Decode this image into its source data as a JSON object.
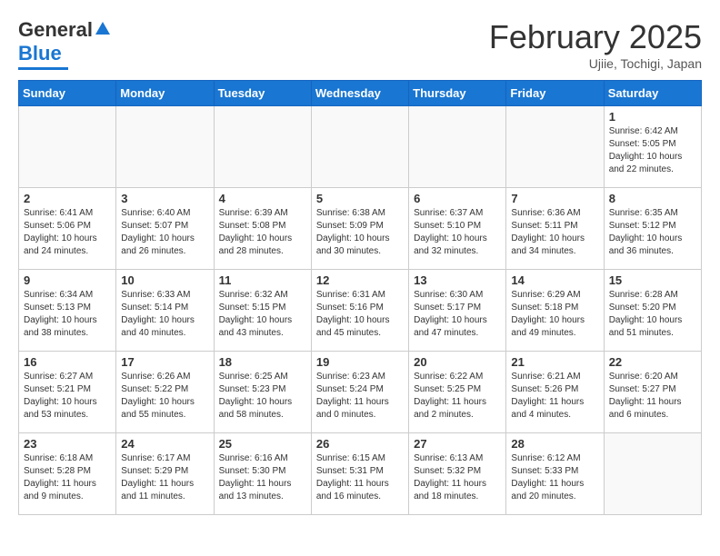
{
  "header": {
    "logo_general": "General",
    "logo_blue": "Blue",
    "month_title": "February 2025",
    "location": "Ujiie, Tochigi, Japan"
  },
  "weekdays": [
    "Sunday",
    "Monday",
    "Tuesday",
    "Wednesday",
    "Thursday",
    "Friday",
    "Saturday"
  ],
  "weeks": [
    [
      {
        "day": "",
        "info": ""
      },
      {
        "day": "",
        "info": ""
      },
      {
        "day": "",
        "info": ""
      },
      {
        "day": "",
        "info": ""
      },
      {
        "day": "",
        "info": ""
      },
      {
        "day": "",
        "info": ""
      },
      {
        "day": "1",
        "info": "Sunrise: 6:42 AM\nSunset: 5:05 PM\nDaylight: 10 hours and 22 minutes."
      }
    ],
    [
      {
        "day": "2",
        "info": "Sunrise: 6:41 AM\nSunset: 5:06 PM\nDaylight: 10 hours and 24 minutes."
      },
      {
        "day": "3",
        "info": "Sunrise: 6:40 AM\nSunset: 5:07 PM\nDaylight: 10 hours and 26 minutes."
      },
      {
        "day": "4",
        "info": "Sunrise: 6:39 AM\nSunset: 5:08 PM\nDaylight: 10 hours and 28 minutes."
      },
      {
        "day": "5",
        "info": "Sunrise: 6:38 AM\nSunset: 5:09 PM\nDaylight: 10 hours and 30 minutes."
      },
      {
        "day": "6",
        "info": "Sunrise: 6:37 AM\nSunset: 5:10 PM\nDaylight: 10 hours and 32 minutes."
      },
      {
        "day": "7",
        "info": "Sunrise: 6:36 AM\nSunset: 5:11 PM\nDaylight: 10 hours and 34 minutes."
      },
      {
        "day": "8",
        "info": "Sunrise: 6:35 AM\nSunset: 5:12 PM\nDaylight: 10 hours and 36 minutes."
      }
    ],
    [
      {
        "day": "9",
        "info": "Sunrise: 6:34 AM\nSunset: 5:13 PM\nDaylight: 10 hours and 38 minutes."
      },
      {
        "day": "10",
        "info": "Sunrise: 6:33 AM\nSunset: 5:14 PM\nDaylight: 10 hours and 40 minutes."
      },
      {
        "day": "11",
        "info": "Sunrise: 6:32 AM\nSunset: 5:15 PM\nDaylight: 10 hours and 43 minutes."
      },
      {
        "day": "12",
        "info": "Sunrise: 6:31 AM\nSunset: 5:16 PM\nDaylight: 10 hours and 45 minutes."
      },
      {
        "day": "13",
        "info": "Sunrise: 6:30 AM\nSunset: 5:17 PM\nDaylight: 10 hours and 47 minutes."
      },
      {
        "day": "14",
        "info": "Sunrise: 6:29 AM\nSunset: 5:18 PM\nDaylight: 10 hours and 49 minutes."
      },
      {
        "day": "15",
        "info": "Sunrise: 6:28 AM\nSunset: 5:20 PM\nDaylight: 10 hours and 51 minutes."
      }
    ],
    [
      {
        "day": "16",
        "info": "Sunrise: 6:27 AM\nSunset: 5:21 PM\nDaylight: 10 hours and 53 minutes."
      },
      {
        "day": "17",
        "info": "Sunrise: 6:26 AM\nSunset: 5:22 PM\nDaylight: 10 hours and 55 minutes."
      },
      {
        "day": "18",
        "info": "Sunrise: 6:25 AM\nSunset: 5:23 PM\nDaylight: 10 hours and 58 minutes."
      },
      {
        "day": "19",
        "info": "Sunrise: 6:23 AM\nSunset: 5:24 PM\nDaylight: 11 hours and 0 minutes."
      },
      {
        "day": "20",
        "info": "Sunrise: 6:22 AM\nSunset: 5:25 PM\nDaylight: 11 hours and 2 minutes."
      },
      {
        "day": "21",
        "info": "Sunrise: 6:21 AM\nSunset: 5:26 PM\nDaylight: 11 hours and 4 minutes."
      },
      {
        "day": "22",
        "info": "Sunrise: 6:20 AM\nSunset: 5:27 PM\nDaylight: 11 hours and 6 minutes."
      }
    ],
    [
      {
        "day": "23",
        "info": "Sunrise: 6:18 AM\nSunset: 5:28 PM\nDaylight: 11 hours and 9 minutes."
      },
      {
        "day": "24",
        "info": "Sunrise: 6:17 AM\nSunset: 5:29 PM\nDaylight: 11 hours and 11 minutes."
      },
      {
        "day": "25",
        "info": "Sunrise: 6:16 AM\nSunset: 5:30 PM\nDaylight: 11 hours and 13 minutes."
      },
      {
        "day": "26",
        "info": "Sunrise: 6:15 AM\nSunset: 5:31 PM\nDaylight: 11 hours and 16 minutes."
      },
      {
        "day": "27",
        "info": "Sunrise: 6:13 AM\nSunset: 5:32 PM\nDaylight: 11 hours and 18 minutes."
      },
      {
        "day": "28",
        "info": "Sunrise: 6:12 AM\nSunset: 5:33 PM\nDaylight: 11 hours and 20 minutes."
      },
      {
        "day": "",
        "info": ""
      }
    ]
  ]
}
